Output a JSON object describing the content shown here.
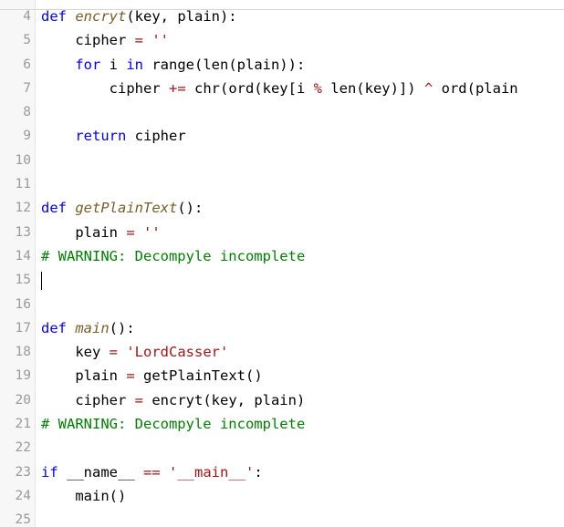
{
  "editor": {
    "language": "python",
    "lines": [
      {
        "n": "4",
        "tokens": [
          {
            "t": "kw",
            "v": "def "
          },
          {
            "t": "fn",
            "v": "encryt"
          },
          {
            "t": "tx",
            "v": "(key, plain):"
          }
        ]
      },
      {
        "n": "5",
        "tokens": [
          {
            "t": "tx",
            "v": "    cipher "
          },
          {
            "t": "op",
            "v": "="
          },
          {
            "t": "tx",
            "v": " "
          },
          {
            "t": "str",
            "v": "''"
          }
        ]
      },
      {
        "n": "6",
        "tokens": [
          {
            "t": "tx",
            "v": "    "
          },
          {
            "t": "kw",
            "v": "for"
          },
          {
            "t": "tx",
            "v": " i "
          },
          {
            "t": "kw",
            "v": "in"
          },
          {
            "t": "tx",
            "v": " range(len(plain)):"
          }
        ]
      },
      {
        "n": "7",
        "tokens": [
          {
            "t": "tx",
            "v": "        cipher "
          },
          {
            "t": "op",
            "v": "+="
          },
          {
            "t": "tx",
            "v": " chr(ord(key[i "
          },
          {
            "t": "op",
            "v": "%"
          },
          {
            "t": "tx",
            "v": " len(key)]) "
          },
          {
            "t": "op",
            "v": "^"
          },
          {
            "t": "tx",
            "v": " ord(plain"
          }
        ]
      },
      {
        "n": "8",
        "tokens": []
      },
      {
        "n": "9",
        "tokens": [
          {
            "t": "tx",
            "v": "    "
          },
          {
            "t": "kw",
            "v": "return"
          },
          {
            "t": "tx",
            "v": " cipher"
          }
        ]
      },
      {
        "n": "10",
        "tokens": []
      },
      {
        "n": "11",
        "tokens": []
      },
      {
        "n": "12",
        "tokens": [
          {
            "t": "kw",
            "v": "def "
          },
          {
            "t": "fn",
            "v": "getPlainText"
          },
          {
            "t": "tx",
            "v": "():"
          }
        ]
      },
      {
        "n": "13",
        "tokens": [
          {
            "t": "tx",
            "v": "    plain "
          },
          {
            "t": "op",
            "v": "="
          },
          {
            "t": "tx",
            "v": " "
          },
          {
            "t": "str",
            "v": "''"
          }
        ]
      },
      {
        "n": "14",
        "tokens": [
          {
            "t": "cm",
            "v": "# WARNING: Decompyle incomplete"
          }
        ]
      },
      {
        "n": "15",
        "tokens": [],
        "cursor": true
      },
      {
        "n": "16",
        "tokens": []
      },
      {
        "n": "17",
        "tokens": [
          {
            "t": "kw",
            "v": "def "
          },
          {
            "t": "fn",
            "v": "main"
          },
          {
            "t": "tx",
            "v": "():"
          }
        ]
      },
      {
        "n": "18",
        "tokens": [
          {
            "t": "tx",
            "v": "    key "
          },
          {
            "t": "op",
            "v": "="
          },
          {
            "t": "tx",
            "v": " "
          },
          {
            "t": "str",
            "v": "'LordCasser'"
          }
        ]
      },
      {
        "n": "19",
        "tokens": [
          {
            "t": "tx",
            "v": "    plain "
          },
          {
            "t": "op",
            "v": "="
          },
          {
            "t": "tx",
            "v": " getPlainText()"
          }
        ]
      },
      {
        "n": "20",
        "tokens": [
          {
            "t": "tx",
            "v": "    cipher "
          },
          {
            "t": "op",
            "v": "="
          },
          {
            "t": "tx",
            "v": " encryt(key, plain)"
          }
        ]
      },
      {
        "n": "21",
        "tokens": [
          {
            "t": "cm",
            "v": "# WARNING: Decompyle incomplete"
          }
        ]
      },
      {
        "n": "22",
        "tokens": []
      },
      {
        "n": "23",
        "tokens": [
          {
            "t": "kw",
            "v": "if"
          },
          {
            "t": "tx",
            "v": " __name__ "
          },
          {
            "t": "op",
            "v": "=="
          },
          {
            "t": "tx",
            "v": " "
          },
          {
            "t": "str",
            "v": "'__main__'"
          },
          {
            "t": "tx",
            "v": ":"
          }
        ]
      },
      {
        "n": "24",
        "tokens": [
          {
            "t": "tx",
            "v": "    main()"
          }
        ]
      },
      {
        "n": "25",
        "tokens": []
      }
    ]
  },
  "colors": {
    "keyword": "#0000ff",
    "function_name": "#795e26",
    "string": "#a31515",
    "comment": "#008000",
    "line_number": "#9a9a9a"
  }
}
